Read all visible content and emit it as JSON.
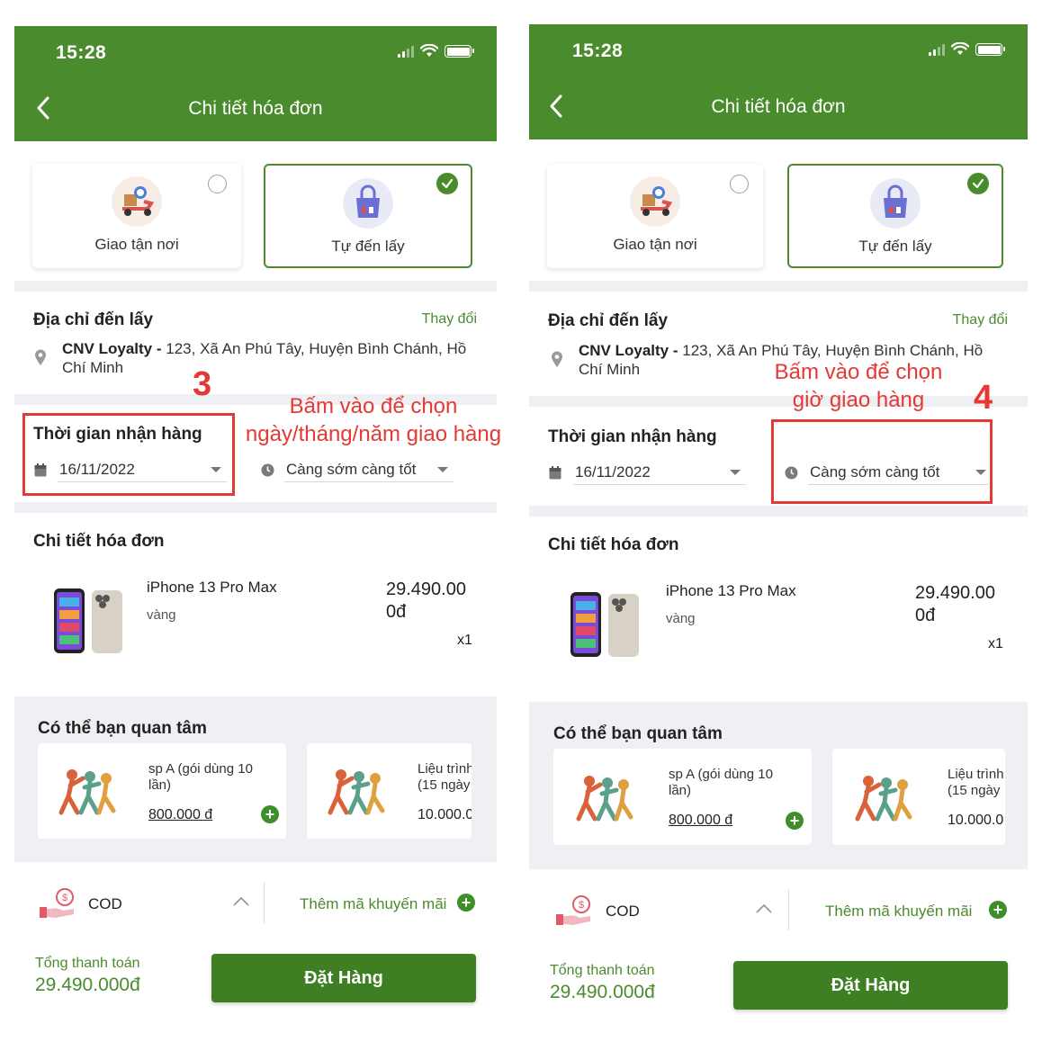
{
  "status_bar": {
    "time": "15:28"
  },
  "header": {
    "title": "Chi tiết hóa đơn"
  },
  "delivery_options": [
    {
      "label": "Giao tận nơi",
      "selected": false,
      "icon": "delivery-scooter-icon"
    },
    {
      "label": "Tự đến lấy",
      "selected": true,
      "icon": "pickup-bag-icon"
    }
  ],
  "pickup_address": {
    "title": "Địa chỉ đến lấy",
    "change_link": "Thay đổi",
    "store_name": "CNV Loyalty -",
    "address": "123, Xã An Phú Tây, Huyện Bình Chánh, Hồ Chí Minh"
  },
  "receive_time": {
    "title": "Thời gian nhận hàng",
    "date": "16/11/2022",
    "time_slot": "Càng sớm càng tốt"
  },
  "invoice": {
    "title": "Chi tiết hóa đơn",
    "items": [
      {
        "name": "iPhone 13 Pro Max",
        "variant": "vàng",
        "price_line1": "29.490.00",
        "price_line2": "0đ",
        "quantity": "x1"
      }
    ]
  },
  "recommendations": {
    "title": "Có thể bạn quan tâm",
    "items": [
      {
        "name_line1": "sp A (gói dùng 10",
        "name_line2": "lần)",
        "price": "800.000 đ"
      },
      {
        "name_line1": "Liệu trình",
        "name_line2": "(15 ngày",
        "price": "10.000.0"
      }
    ]
  },
  "payment": {
    "method": "COD",
    "promo_link": "Thêm mã khuyến mãi"
  },
  "checkout": {
    "total_label": "Tổng thanh toán",
    "total_value": "29.490.000đ",
    "order_button": "Đặt Hàng"
  },
  "annotations": {
    "step3_number": "3",
    "step3_line1": "Bấm vào để chọn",
    "step3_line2": "ngày/tháng/năm giao hàng",
    "step4_number": "4",
    "step4_line1": "Bấm vào để chọn",
    "step4_line2": "giờ giao hàng"
  },
  "colors": {
    "brand_green": "#4a8c2d",
    "annotation_red": "#e53935",
    "section_gray": "#eef0f3"
  }
}
